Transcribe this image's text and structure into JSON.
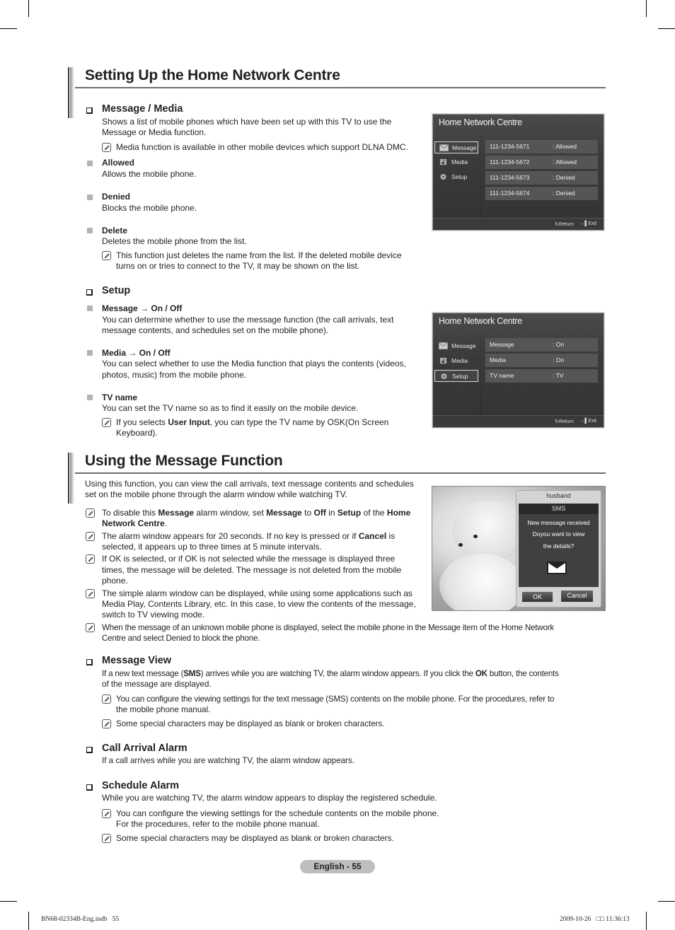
{
  "sections": {
    "home_network": {
      "title": "Setting Up the Home Network Centre",
      "message_media": {
        "heading": "Message / Media",
        "desc_line1": "Shows a list of mobile phones which have been set up with this TV to use the",
        "desc_line2": "Message or Media function.",
        "note": "Media function is available in other mobile devices which support DLNA DMC.",
        "items": [
          {
            "title": "Allowed",
            "desc": "Allows the mobile phone."
          },
          {
            "title": "Denied",
            "desc": "Blocks the mobile phone."
          },
          {
            "title": "Delete",
            "desc": "Deletes the mobile phone from the list."
          }
        ],
        "delete_note_line1": "This function just deletes the name from the list. If the deleted mobile device",
        "delete_note_line2": "turns on or tries to connect to the TV, it may be shown on the list."
      },
      "setup": {
        "heading": "Setup",
        "items": [
          {
            "title": "Message → On / Off",
            "line1": "You can determine whether to use the message function (the call arrivals, text",
            "line2": "message contents, and schedules set on the mobile phone)."
          },
          {
            "title": "Media → On / Off",
            "line1": "You can select whether to use the Media function that plays the contents (videos,",
            "line2": "photos, music) from the mobile phone."
          },
          {
            "title": "TV name",
            "line1": "You can set the TV name so as to find it easily on the mobile device."
          }
        ],
        "tvname_note_pre": "If you selects ",
        "tvname_note_bold": "User Input",
        "tvname_note_post": ", you can type the TV name by OSK(On Screen",
        "tvname_note_line2": "Keyboard)."
      }
    },
    "message_function": {
      "title": "Using the Message Function",
      "intro_line1": "Using this function, you can view the call arrivals, text message contents and schedules",
      "intro_line2": "set on the mobile phone through the alarm window while watching TV.",
      "notes": {
        "n1": {
          "a": "To disable this ",
          "b": "Message",
          "c": " alarm window, set ",
          "d": "Message",
          "e": " to ",
          "f": "Off",
          "g": " in ",
          "h": "Setup",
          "i": " of the ",
          "j": "Home",
          "k": "Network Centre",
          "l": "."
        },
        "n2": {
          "a": "The alarm window appears for 20 seconds. If no key is pressed or if ",
          "b": "Cancel",
          "c": " is",
          "line2": "selected, it appears up to three times at 5 minute intervals."
        },
        "n3": {
          "line1": "If OK is selected, or if OK is not selected while the message is displayed three",
          "line2": "times, the message will be deleted. The message is not deleted from the mobile",
          "line3": "phone."
        },
        "n4": {
          "line1": "The simple alarm window can be displayed, while using some applications such as",
          "line2": "Media Play, Contents Library, etc. In this case, to view the contents of the message,",
          "line3": "switch to TV viewing mode."
        },
        "n5": {
          "line1": "When the message of an unknown mobile phone is displayed, select the mobile phone in the Message item of the Home Network",
          "line2": "Centre and select Denied to block the phone."
        }
      },
      "message_view": {
        "heading": "Message View",
        "a": "If a new text message (",
        "b": "SMS",
        "c": ") arrives while you are watching TV, the alarm window appears. If you click the ",
        "d": "OK",
        "e": " button, the contents",
        "line2": "of the message are displayed.",
        "note1_line1": "You can configure the viewing settings for the text message (SMS) contents on the mobile phone. For the procedures, refer to",
        "note1_line2": "the mobile phone manual.",
        "note2": "Some special characters may be displayed as blank or broken characters."
      },
      "call_arrival": {
        "heading": "Call Arrival Alarm",
        "desc": "If a call arrives while you are watching TV, the alarm window appears."
      },
      "schedule": {
        "heading": "Schedule Alarm",
        "desc": "While you are watching TV, the alarm window appears to display the registered schedule.",
        "note1_line1": "You can configure the viewing settings for the schedule contents on the mobile phone.",
        "note1_line2": "For the procedures, refer to the mobile phone manual.",
        "note2": "Some special characters may be displayed as blank or broken characters."
      }
    }
  },
  "tv_screen_1": {
    "title": "Home Network Centre",
    "menu": [
      "Message",
      "Media",
      "Setup"
    ],
    "selected": "Message",
    "rows": [
      {
        "number": "111-1234-5671",
        "status": ":  Allowed"
      },
      {
        "number": "111-1234-5672",
        "status": ":  Allowed"
      },
      {
        "number": "111-1234-5673",
        "status": ":  Denied"
      },
      {
        "number": "111-1234-5674",
        "status": ":  Denied"
      }
    ],
    "return_label": "Return",
    "exit_label": "Exit"
  },
  "tv_screen_2": {
    "title": "Home Network Centre",
    "menu": [
      "Message",
      "Media",
      "Setup"
    ],
    "selected": "Setup",
    "rows": [
      {
        "name": "Message",
        "value": ": On"
      },
      {
        "name": "Media",
        "value": ": On"
      },
      {
        "name": "TV name",
        "value": ": TV"
      }
    ],
    "return_label": "Return",
    "exit_label": "Exit"
  },
  "alarm_window": {
    "sender": "husband",
    "type": "SMS",
    "line1": "New message received",
    "line2": "Doyou want to view",
    "line3": "the details?",
    "ok_label": "OK",
    "cancel_label": "Cancel"
  },
  "page_label": "English - 55",
  "footer": {
    "file": "BN68-02334B-Eng.indb   55",
    "timestamp": "2009-10-26   □□ 11:36:13"
  }
}
